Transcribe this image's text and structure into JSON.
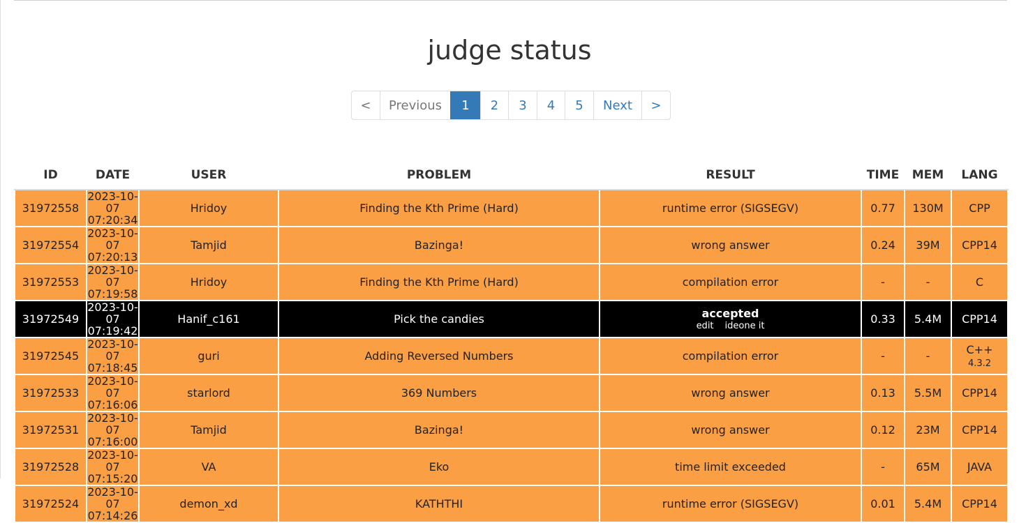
{
  "page": {
    "title": "judge status"
  },
  "pagination": {
    "first": "<",
    "previous": "Previous",
    "pages": [
      "1",
      "2",
      "3",
      "4",
      "5"
    ],
    "active_page": "1",
    "next": "Next",
    "last": ">"
  },
  "table": {
    "headers": {
      "id": "ID",
      "date": "DATE",
      "user": "USER",
      "problem": "PROBLEM",
      "result": "RESULT",
      "time": "TIME",
      "mem": "MEM",
      "lang": "LANG"
    },
    "rows": [
      {
        "id": "31972558",
        "date": "2023-10-07",
        "clock": "07:20:34",
        "user": "Hridoy",
        "problem": "Finding the Kth Prime (Hard)",
        "result": "runtime error (SIGSEGV)",
        "time": "0.77",
        "mem": "130M",
        "lang": "CPP"
      },
      {
        "id": "31972554",
        "date": "2023-10-07",
        "clock": "07:20:13",
        "user": "Tamjid",
        "problem": "Bazinga!",
        "result": "wrong answer",
        "time": "0.24",
        "mem": "39M",
        "lang": "CPP14"
      },
      {
        "id": "31972553",
        "date": "2023-10-07",
        "clock": "07:19:58",
        "user": "Hridoy",
        "problem": "Finding the Kth Prime (Hard)",
        "result": "compilation error",
        "time": "-",
        "mem": "-",
        "lang": "C"
      },
      {
        "id": "31972549",
        "date": "2023-10-07",
        "clock": "07:19:42",
        "user": "Hanif_c161",
        "problem": "Pick the candies",
        "result": "accepted",
        "result_links": [
          "edit",
          "ideone it"
        ],
        "time": "0.33",
        "mem": "5.4M",
        "lang": "CPP14"
      },
      {
        "id": "31972545",
        "date": "2023-10-07",
        "clock": "07:18:45",
        "user": "guri",
        "problem": "Adding Reversed Numbers",
        "result": "compilation error",
        "time": "-",
        "mem": "-",
        "lang": "C++",
        "lang_version": "4.3.2"
      },
      {
        "id": "31972533",
        "date": "2023-10-07",
        "clock": "07:16:06",
        "user": "starlord",
        "problem": "369 Numbers",
        "result": "wrong answer",
        "time": "0.13",
        "mem": "5.5M",
        "lang": "CPP14"
      },
      {
        "id": "31972531",
        "date": "2023-10-07",
        "clock": "07:16:00",
        "user": "Tamjid",
        "problem": "Bazinga!",
        "result": "wrong answer",
        "time": "0.12",
        "mem": "23M",
        "lang": "CPP14"
      },
      {
        "id": "31972528",
        "date": "2023-10-07",
        "clock": "07:15:20",
        "user": "VA",
        "problem": "Eko",
        "result": "time limit exceeded",
        "time": "-",
        "mem": "65M",
        "lang": "JAVA"
      },
      {
        "id": "31972524",
        "date": "2023-10-07",
        "clock": "07:14:26",
        "user": "demon_xd",
        "problem": "KATHTHI",
        "result": "runtime error (SIGSEGV)",
        "time": "0.01",
        "mem": "5.4M",
        "lang": "CPP14"
      }
    ]
  },
  "colors": {
    "row_bg": "#fb9f44",
    "accepted_bg": "#000000",
    "active_page": "#337ab7",
    "link": "#337ab7"
  }
}
